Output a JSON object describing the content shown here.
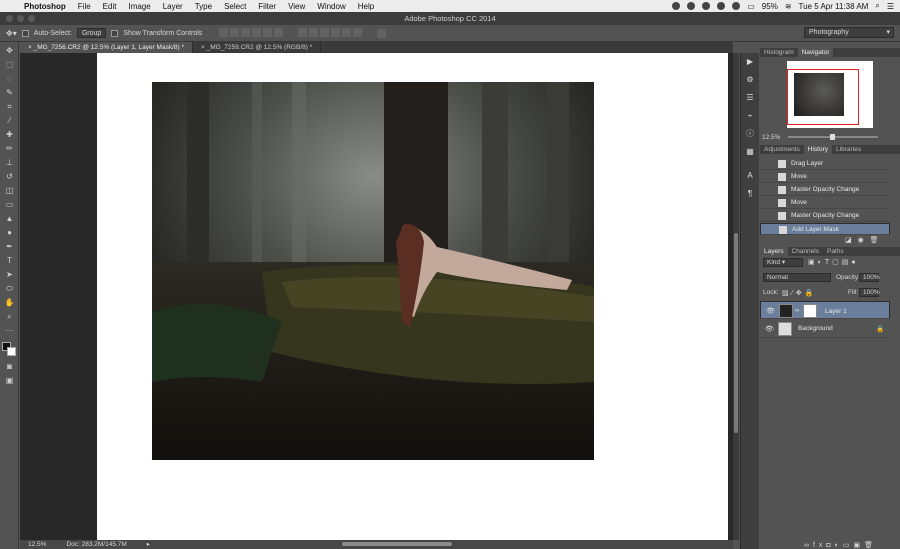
{
  "menubar": {
    "app": "Photoshop",
    "items": [
      "File",
      "Edit",
      "Image",
      "Layer",
      "Type",
      "Select",
      "Filter",
      "View",
      "Window",
      "Help"
    ],
    "battery": "95%",
    "clock": "Tue 5 Apr  11:38 AM"
  },
  "window": {
    "title": "Adobe Photoshop CC 2014"
  },
  "options": {
    "auto_select_label": "Auto-Select:",
    "auto_select_value": "Group",
    "transform_label": "Show Transform Controls",
    "workspace": "Photography"
  },
  "tabs": [
    {
      "label": "_MG_7256.CR2 @ 12.5% (Layer 1, Layer Mask/8) *",
      "active": true
    },
    {
      "label": "_MG_7259.CR2 @ 12.5% (RGB/8) *",
      "active": false
    }
  ],
  "status": {
    "zoom": "12.5%",
    "doc": "Doc: 283.2M/145.7M"
  },
  "navigator": {
    "tabs": [
      "Histogram",
      "Navigator"
    ],
    "zoom": "12.5%"
  },
  "history": {
    "tabs": [
      "Adjustments",
      "History",
      "Libraries"
    ],
    "items": [
      "Drag Layer",
      "Move",
      "Master Opacity Change",
      "Move",
      "Master Opacity Change",
      "Add Layer Mask"
    ]
  },
  "layers": {
    "tabs": [
      "Layers",
      "Channels",
      "Paths"
    ],
    "filter": "Kind",
    "blend": "Normal",
    "opacity_label": "Opacity:",
    "opacity": "100%",
    "lock_label": "Lock:",
    "fill_label": "Fill:",
    "fill": "100%",
    "items": [
      "Layer 1",
      "Background"
    ]
  },
  "colors": {
    "selection": "#6b7f9c",
    "navbox": "#e02020"
  }
}
